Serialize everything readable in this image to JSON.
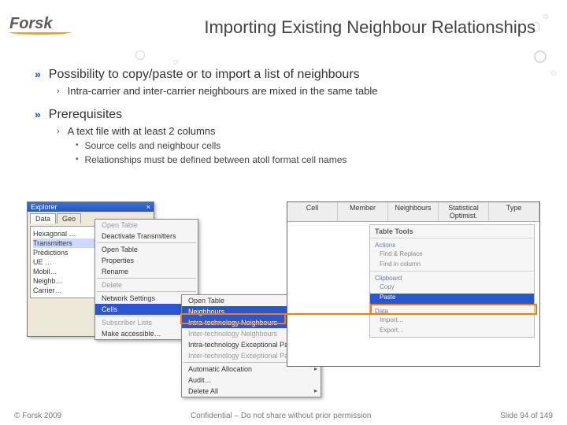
{
  "header": {
    "logo_text": "Forsk",
    "title": "Importing Existing Neighbour Relationships"
  },
  "bullets": {
    "b1": "Possibility to copy/paste or to import a list of neighbours",
    "b1a": "Intra-carrier and inter-carrier neighbours are mixed in the same table",
    "b2": "Prerequisites",
    "b2a": "A text file with at least 2 columns",
    "b2a1": "Source cells and neighbour cells",
    "b2a2": "Relationships must be defined between atoll format cell names"
  },
  "explorer": {
    "title": "Explorer",
    "close": "×",
    "tabs": {
      "data": "Data",
      "geo": "Geo"
    },
    "items": [
      "Hexagonal …",
      "Transmitters",
      "Predictions",
      "UE …",
      "Mobil…",
      "Neighb…",
      "Carrier…"
    ]
  },
  "ctx1": {
    "i1": "Open Table",
    "i2": "Deactivate Transmitters",
    "i3": "Open Table",
    "i4": "Properties",
    "i5": "Rename",
    "i6": "Delete",
    "i7": "Network Settings",
    "i8": "Cells",
    "i9": "Subscriber Lists",
    "i10": "Make accessible…"
  },
  "ctx2": {
    "i1": "Open Table",
    "i2": "Neighbours",
    "i3": "Intra-technology Neighbours",
    "i4": "Inter-technology Neighbours",
    "i5": "Intra-technology Exceptional Pairs",
    "i6": "Inter-technology Exceptional Pairs",
    "i7": "Automatic Allocation",
    "i8": "Audit…",
    "i9": "Delete All"
  },
  "grid": {
    "cols": {
      "c1": "Cell",
      "c2": "Member",
      "c3": "Neighbours",
      "c4": "Statistical Optimist.",
      "c5": "Type"
    },
    "panel_title": "Table Tools",
    "g1_label": "Actions",
    "g1_opts": [
      "Find & Replace",
      "Find in column"
    ],
    "g2_label": "Clipboard",
    "g2_opts": [
      "Copy",
      "Paste"
    ],
    "g3_label": "Data",
    "g3_opts": [
      "Import…",
      "Export…"
    ]
  },
  "footer": {
    "left": "© Forsk 2009",
    "center": "Confidential – Do not share without prior permission",
    "right": "Slide 94 of 149"
  }
}
